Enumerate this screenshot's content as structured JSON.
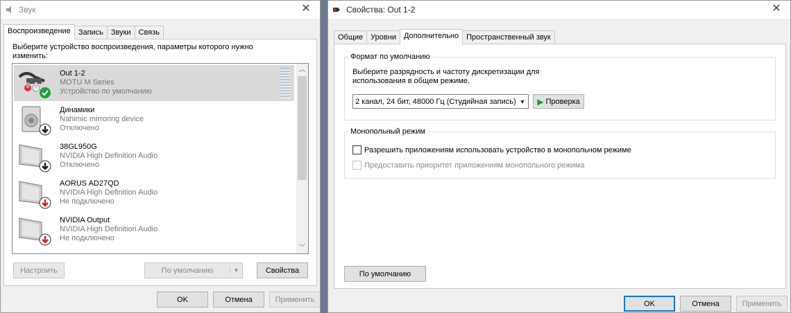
{
  "sound_dialog": {
    "title": "Звук",
    "tabs": [
      "Воспроизведение",
      "Запись",
      "Звуки",
      "Связь"
    ],
    "instruction": "Выберите устройство воспроизведения, параметры которого нужно изменить:",
    "devices": [
      {
        "name": "Out 1-2",
        "driver": "MOTU M Series",
        "status": "Устройство по умолчанию",
        "icon": "speaker-cable-icon",
        "badge": "check-badge-icon",
        "badge_color": "#1e9e3a"
      },
      {
        "name": "Динамики",
        "driver": "Nahimic mirroring device",
        "status": "Отключено",
        "icon": "speaker-icon",
        "badge": "down-arrow-badge-icon",
        "badge_color": "#222222"
      },
      {
        "name": "38GL950G",
        "driver": "NVIDIA High Definition Audio",
        "status": "Отключено",
        "icon": "monitor-icon",
        "badge": "down-arrow-badge-icon",
        "badge_color": "#222222"
      },
      {
        "name": "AORUS AD27QD",
        "driver": "NVIDIA High Definition Audio",
        "status": "Не подключено",
        "icon": "monitor-icon",
        "badge": "down-arrow-badge-icon",
        "badge_color": "#d42020"
      },
      {
        "name": "NVIDIA Output",
        "driver": "NVIDIA High Definition Audio",
        "status": "Не подключено",
        "icon": "monitor-icon",
        "badge": "down-arrow-badge-icon",
        "badge_color": "#d42020"
      }
    ],
    "buttons": {
      "configure": "Настроить",
      "set_default": "По умолчанию",
      "properties": "Свойства"
    },
    "footer": {
      "ok": "OK",
      "cancel": "Отмена",
      "apply": "Применить"
    }
  },
  "properties_dialog": {
    "title": "Свойства: Out 1-2",
    "tabs": [
      "Общие",
      "Уровни",
      "Дополнительно",
      "Пространственный звук"
    ],
    "default_format": {
      "label": "Формат по умолчанию",
      "description_line1": "Выберите разрядность и частоту дискретизации для",
      "description_line2": "использования в общем режиме.",
      "selected_format": "2 канал, 24 бит, 48000 Гц (Студийная запись)",
      "test_button": "Проверка"
    },
    "exclusive_mode": {
      "label": "Монопольный режим",
      "allow_exclusive": "Разрешить приложениям использовать устройство в монопольном режиме",
      "give_priority": "Предоставить приоритет приложениям монопольного режима"
    },
    "restore_defaults": "По умолчанию",
    "footer": {
      "ok": "OK",
      "cancel": "Отмена",
      "apply": "Применить"
    }
  },
  "colors": {
    "accent": "#0078d7",
    "selection": "#d9d9d9",
    "play_green": "#1fa11f"
  }
}
